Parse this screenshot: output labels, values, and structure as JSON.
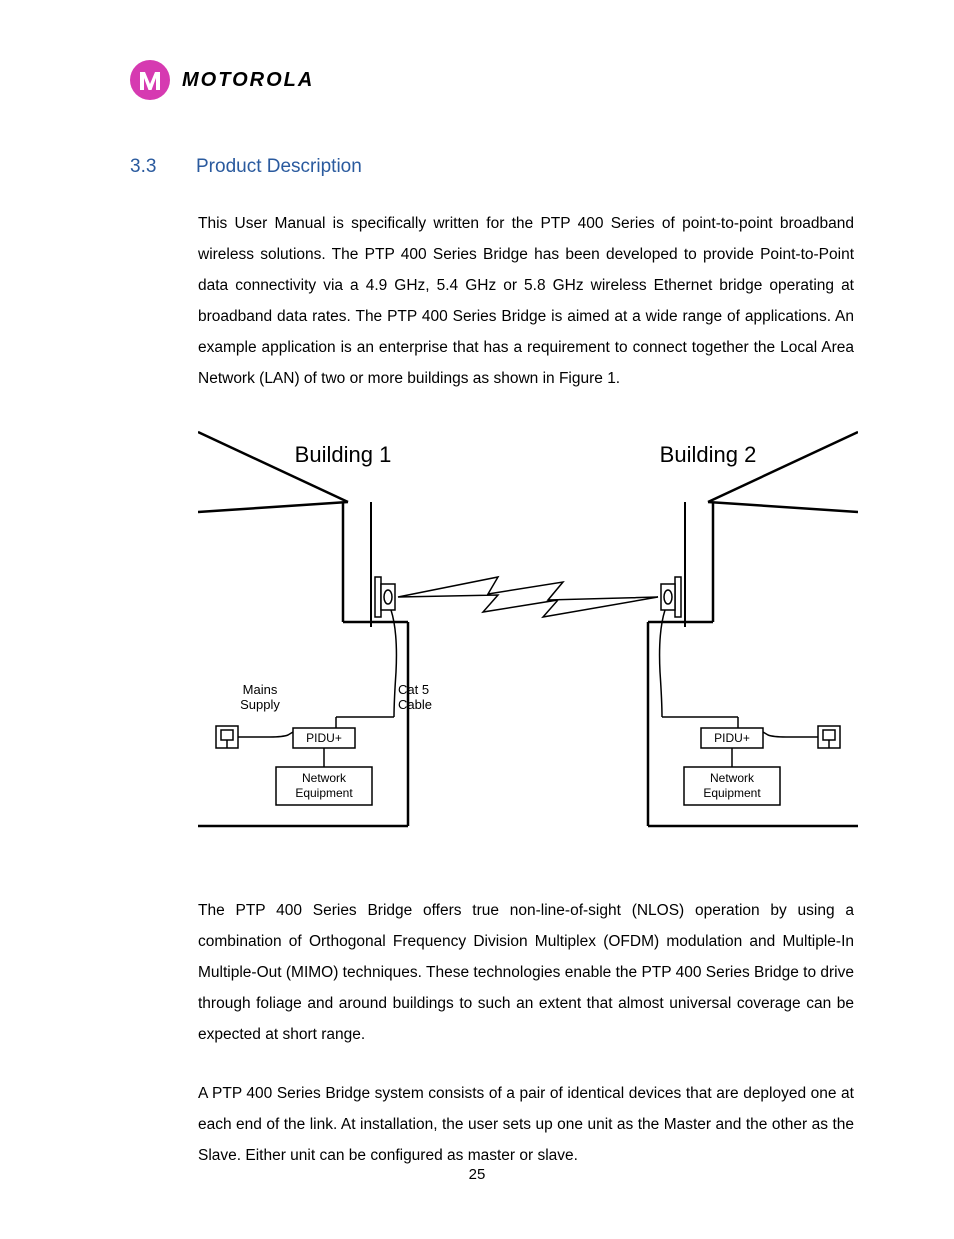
{
  "logo": {
    "brand": "MOTOROLA"
  },
  "heading": {
    "num": "3.3",
    "title": "Product Description"
  },
  "para1": "This User Manual is specifically written for the PTP 400 Series of point-to-point broadband wireless solutions. The PTP 400 Series Bridge has been developed to provide Point-to-Point data connectivity via a 4.9 GHz, 5.4 GHz or 5.8 GHz wireless Ethernet bridge operating at broadband data rates. The PTP 400 Series Bridge is aimed at a wide range of applications. An example application is an enterprise that has a requirement to connect together the Local Area Network (LAN) of two or more buildings as shown in Figure 1.",
  "fig": {
    "building1": "Building 1",
    "building2": "Building 2",
    "mains_l1": "Mains",
    "mains_l2": "Supply",
    "cat5_l1": "Cat 5",
    "cat5_l2": "Cable",
    "pidu1": "PIDU+",
    "pidu2": "PIDU+",
    "neteq1_l1": "Network",
    "neteq1_l2": "Equipment",
    "neteq2_l1": "Network",
    "neteq2_l2": "Equipment"
  },
  "para2": "The PTP 400 Series Bridge offers true non-line-of-sight (NLOS) operation by using a combination of Orthogonal Frequency Division Multiplex (OFDM) modulation and Multiple-In Multiple-Out (MIMO) techniques. These technologies enable the PTP 400 Series Bridge to drive through foliage and around buildings to such an extent that almost universal coverage can be expected at short range.",
  "para3": "A PTP 400 Series Bridge system consists of a pair of identical devices that are deployed one at each end of the link. At installation, the user sets up one unit as the Master and the other as the Slave. Either unit can be configured as master or slave.",
  "page_number": "25"
}
